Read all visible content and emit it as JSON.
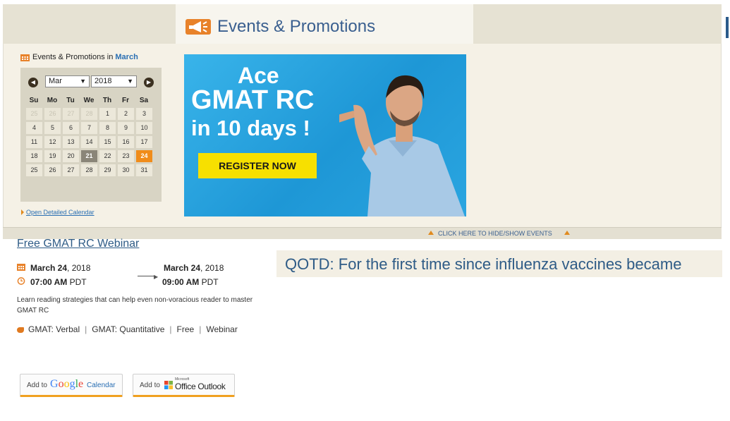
{
  "header": {
    "title": "Events & Promotions"
  },
  "calendar": {
    "heading_prefix": "Events & Promotions in ",
    "heading_month": "March",
    "month_select": "Mar",
    "year_select": "2018",
    "prev_icon": "chevron-left-icon",
    "next_icon": "chevron-right-icon",
    "dow": [
      "Su",
      "Mo",
      "Tu",
      "We",
      "Th",
      "Fr",
      "Sa"
    ],
    "weeks": [
      [
        "25",
        "26",
        "27",
        "28",
        "1",
        "2",
        "3"
      ],
      [
        "4",
        "5",
        "6",
        "7",
        "8",
        "9",
        "10"
      ],
      [
        "11",
        "12",
        "13",
        "14",
        "15",
        "16",
        "17"
      ],
      [
        "18",
        "19",
        "20",
        "21",
        "22",
        "23",
        "24"
      ],
      [
        "25",
        "26",
        "27",
        "28",
        "29",
        "30",
        "31"
      ]
    ],
    "today": "21",
    "selected": "24",
    "open_link": "Open Detailed Calendar"
  },
  "banner": {
    "line1": "Ace",
    "line2": "GMAT RC",
    "line3": "in 10 days !",
    "button": "REGISTER NOW"
  },
  "toggle_bar": {
    "label": "CLICK HERE TO HIDE/SHOW EVENTS"
  },
  "event": {
    "title": "Free GMAT RC Webinar",
    "start_date_md": "March 24",
    "start_date_year": ", 2018",
    "start_time": "07:00 AM",
    "start_tz": " PDT",
    "end_date_md": "March 24",
    "end_date_year": ", 2018",
    "end_time": "09:00 AM",
    "end_tz": " PDT",
    "description": "Learn reading strategies that can help even non-voracious reader to master GMAT RC",
    "tags": [
      "GMAT: Verbal",
      "GMAT: Quantitative",
      "Free",
      "Webinar"
    ]
  },
  "qotd": {
    "text": "QOTD: For the first time since influenza vaccines became"
  },
  "buttons": {
    "google_prefix": "Add to",
    "google_brand": "Google",
    "google_suffix": "Calendar",
    "outlook_prefix": "Add to",
    "outlook_small": "Microsoft",
    "outlook_brand": "Office Outlook"
  },
  "colors": {
    "accent_orange": "#f08c1a",
    "link_blue": "#2e5b86",
    "banner_blue": "#1e97d6",
    "cta_yellow": "#f7e000"
  }
}
